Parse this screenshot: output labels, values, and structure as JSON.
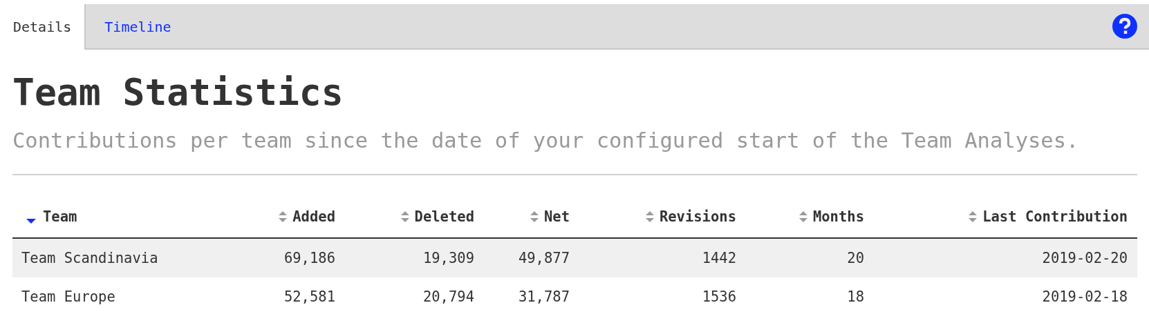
{
  "tabs": [
    {
      "label": "Details",
      "selected": true
    },
    {
      "label": "Timeline",
      "selected": false
    }
  ],
  "title": "Team Statistics",
  "subtitle": "Contributions per team since the date of your configured start of the Team Analyses.",
  "table": {
    "columns": [
      {
        "label": "Team",
        "selected": true
      },
      {
        "label": "Added",
        "selected": false
      },
      {
        "label": "Deleted",
        "selected": false
      },
      {
        "label": "Net",
        "selected": false
      },
      {
        "label": "Revisions",
        "selected": false
      },
      {
        "label": "Months",
        "selected": false
      },
      {
        "label": "Last Contribution",
        "selected": false
      }
    ],
    "rows": [
      [
        "Team Scandinavia",
        "69,186",
        "19,309",
        "49,877",
        "1442",
        "20",
        "2019-02-20"
      ],
      [
        "Team Europe",
        "52,581",
        "20,794",
        "31,787",
        "1536",
        "18",
        "2019-02-18"
      ]
    ]
  }
}
